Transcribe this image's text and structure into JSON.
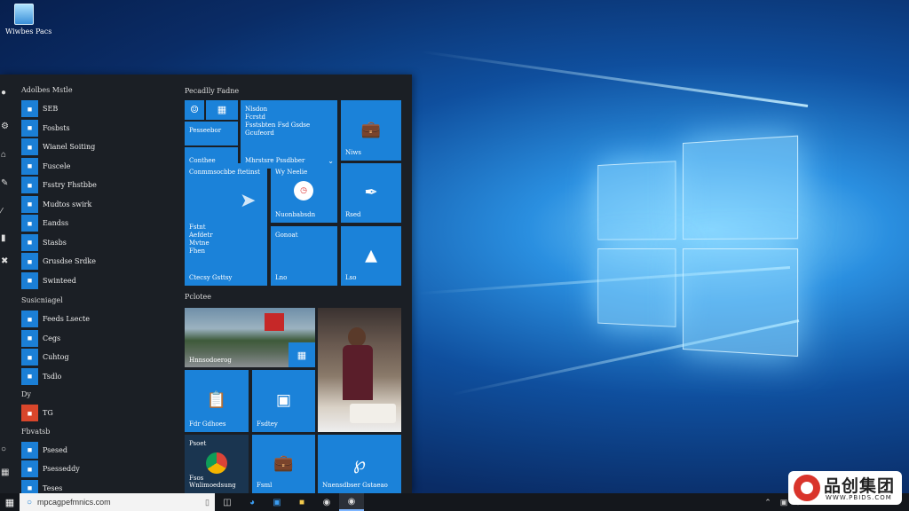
{
  "desktop": {
    "icon_label": "Wiwbes Pacs",
    "icon_name": "recycle-bin-icon"
  },
  "start_menu": {
    "section_recent": "Adolbes Mstle",
    "apps_top": [
      {
        "label": "SEB"
      },
      {
        "label": "Fosbsts"
      },
      {
        "label": "Wianel Soiting"
      },
      {
        "label": "Fuscele"
      },
      {
        "label": "Fsstry Fhstbbe"
      },
      {
        "label": "Mudtos swirk"
      },
      {
        "label": "Eandss"
      },
      {
        "label": "Stasbs"
      },
      {
        "label": "Grusdse Srdke"
      },
      {
        "label": "Swinteed"
      }
    ],
    "section_2": "Susicniagel",
    "apps_mid": [
      {
        "label": "Feeds Lsecte"
      },
      {
        "label": "Cegs"
      },
      {
        "label": "Cuhtog"
      },
      {
        "label": "Tsdlo"
      }
    ],
    "section_3": "Dy",
    "apps_d": [
      {
        "label": "TG"
      }
    ],
    "section_4": "Fbvatsb",
    "apps_bottom": [
      {
        "label": "Psesed"
      },
      {
        "label": "Psesseddy"
      },
      {
        "label": "Teses"
      }
    ],
    "group1_header": "Pecadlly Fadne",
    "group2_header": "Pclotee",
    "tiles": {
      "t1": "Pesseebor",
      "t2": "Conthee",
      "t3_lines": [
        "Nlsdon",
        "Fcrstd",
        "Fsstsbten Fsd Gsdse",
        "Gcufeord"
      ],
      "t3_bottom": "Mhrstsre Pssdbber",
      "t4": "Niws",
      "t5": "Conmmsocbbe ftetinst",
      "t5_lines": [
        "Fstnt",
        "Aefdetr",
        "Mvtne",
        "Fhen"
      ],
      "t5_bottom": "Ctecsy Gsttsy",
      "t6_top": "Wy Neelie",
      "t6_bottom": "Nuonbabsdn",
      "t7": "Rsed",
      "t8": "Gonoat",
      "t8_bottom": "Lno",
      "t9": "Lso",
      "t10": "Hnnsodoerog",
      "t11": "Fdr Gdhoes",
      "t12": "Fsdtey",
      "t13_top": "Psoet",
      "t13_bottom": "Fsos Wnlimoedsung",
      "t14": "Fsml",
      "t15": "Nnensdbser Gstaeao"
    }
  },
  "taskbar": {
    "search_text": "mpcagpefmnics.com",
    "buttons": [
      "task-view-icon",
      "edge-icon",
      "store-icon",
      "folder-icon",
      "chrome-icon",
      "obs-icon"
    ]
  },
  "watermark": {
    "brand_cn": "品创集团",
    "url": "WWW.PBIDS.COM"
  },
  "colors": {
    "tile_blue": "#1b82d9",
    "start_bg": "#1b1f25",
    "taskbar_bg": "#14171c"
  }
}
